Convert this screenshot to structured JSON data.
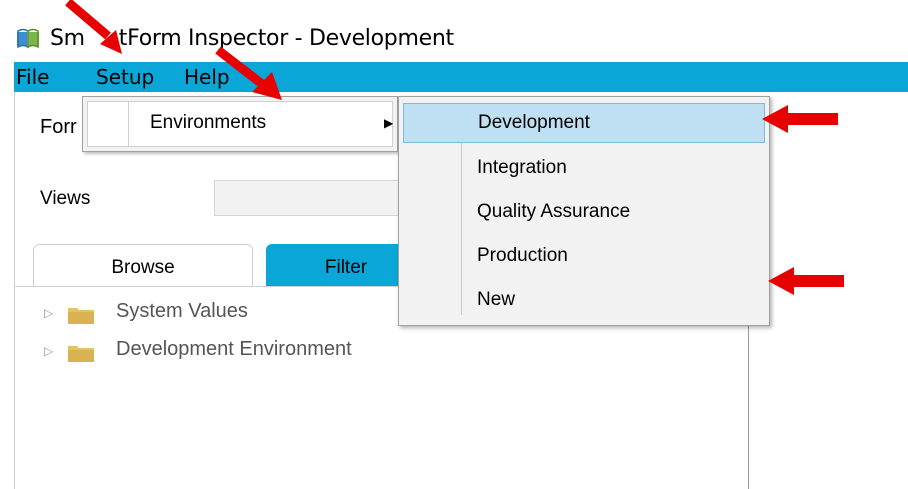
{
  "window": {
    "title": "SmartForm Inspector - Development",
    "title_visible": "Sm",
    "title_rest": "tForm Inspector - Development"
  },
  "menubar": {
    "items": [
      "File",
      "Setup",
      "Help"
    ]
  },
  "form": {
    "form_label": "Forr",
    "views_label": "Views"
  },
  "tabs": [
    {
      "label": "Browse"
    },
    {
      "label": "Filter"
    }
  ],
  "tree": [
    {
      "label": "System Values"
    },
    {
      "label": "Development Environment"
    }
  ],
  "setup_menu": {
    "items": [
      {
        "label": "Environments"
      }
    ]
  },
  "environments_menu": {
    "items": [
      {
        "label": "Development",
        "selected": true
      },
      {
        "label": "Integration",
        "selected": false
      },
      {
        "label": "Quality Assurance",
        "selected": false
      },
      {
        "label": "Production",
        "selected": false
      },
      {
        "label": "New",
        "selected": false
      }
    ]
  },
  "colors": {
    "accent": "#0aa6d8",
    "selection": "#bfe0f2",
    "annotation": "#e60000"
  }
}
